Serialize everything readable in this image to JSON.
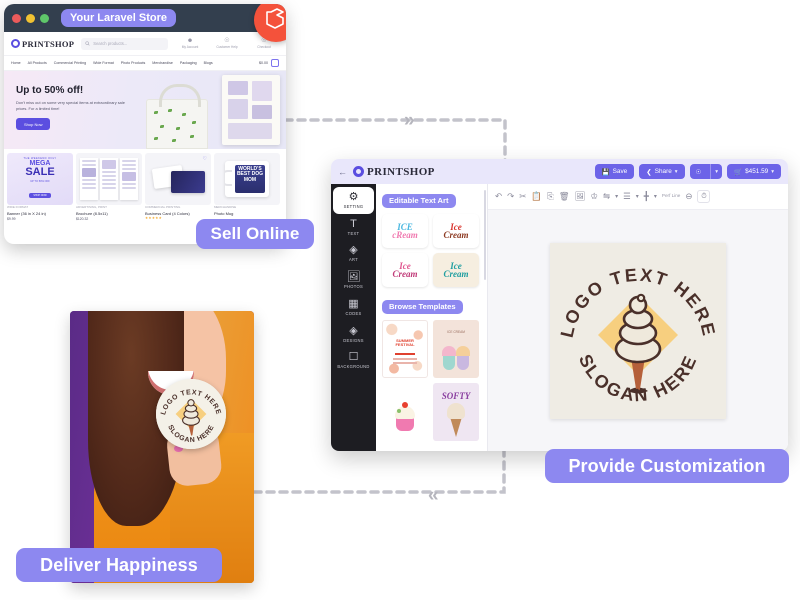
{
  "storefront": {
    "titlebar": {
      "label": "Your Laravel Store",
      "brand_icon": "laravel-logo-icon"
    },
    "header": {
      "logo_text": "PRINTSHOP",
      "search_placeholder": "Search products...",
      "actions": [
        {
          "icon": "user-account-icon",
          "label": "My Account"
        },
        {
          "icon": "help-circle-icon",
          "label": "Customer Help"
        },
        {
          "icon": "cart-checkout-icon",
          "label": "Checkout"
        }
      ]
    },
    "nav": {
      "items": [
        "Home",
        "All Products",
        "Commercial Printing",
        "Wide Format",
        "Photo Products",
        "Merchandise",
        "Packaging",
        "Blogs"
      ],
      "cart_total": "$0.00",
      "cart_count": "0"
    },
    "hero": {
      "title": "Up to 50% off!",
      "subtitle": "Don't miss out on some very special items at extraordinary sale prices. For a limited time!",
      "cta": "Shop Now"
    },
    "products": [
      {
        "category": "WIDE FORMAT",
        "name": "Banner (36 in X 24 in)",
        "price": "$9.99",
        "rating": "",
        "thumb": "mega-sale-banner",
        "banner": {
          "line1": "THE WEEKEND ONLY",
          "line2": "MEGA",
          "line3": "SALE",
          "line4": "UP TO 50% OFF",
          "line5": "SHOP NOW"
        }
      },
      {
        "category": "ADVERTISING, PRINT",
        "name": "Brochure (8.5x11)",
        "price": "$120.32",
        "rating": "",
        "thumb": "brochure-trifold"
      },
      {
        "category": "COMMERCIAL PRINTING",
        "name": "Business Card (4 Colors)",
        "price": "",
        "rating": "★★★★★",
        "thumb": "business-card"
      },
      {
        "category": "MERCHANDISE",
        "name": "Photo Mug",
        "price": "",
        "rating": "",
        "thumb": "photo-mug",
        "mug_text": "WORLD'S BEST DOG MOM"
      }
    ]
  },
  "editor": {
    "header": {
      "back_icon": "arrow-left-icon",
      "logo_text": "PRINTSHOP",
      "save_label": "Save",
      "save_icon": "save-disk-icon",
      "share_label": "Share",
      "share_icon": "share-nodes-icon",
      "account_icon": "user-circle-icon",
      "cart_label": "$451.59",
      "cart_icon": "cart-icon",
      "chevron_icon": "chevron-down-icon"
    },
    "rail": [
      {
        "label": "SETTING",
        "icon": "gear-icon",
        "active": true
      },
      {
        "label": "TEXT",
        "icon": "text-t-icon",
        "active": false
      },
      {
        "label": "ART",
        "icon": "shapes-icon",
        "active": false
      },
      {
        "label": "PHOTOS",
        "icon": "image-icon",
        "active": false
      },
      {
        "label": "CODES",
        "icon": "qr-code-icon",
        "active": false
      },
      {
        "label": "DESIGNS",
        "icon": "shapes-icon",
        "active": false
      },
      {
        "label": "BACKGROUND",
        "icon": "background-icon",
        "active": false
      }
    ],
    "panel": {
      "text_art_title": "Editable Text Art",
      "text_art_tiles": [
        {
          "name": "ice-cream-blue-art",
          "line1": "ICE",
          "line2": "cReam",
          "c1": "#49b7e0",
          "c2": "#f07ab0",
          "bg": "#ffffff"
        },
        {
          "name": "ice-cream-red-art",
          "line1": "Ice",
          "line2": "Cream",
          "c1": "#d8322c",
          "c2": "#8d3a22",
          "bg": "#ffffff"
        },
        {
          "name": "ice-cream-pink-art",
          "line1": "Ice",
          "line2": "Cream",
          "c1": "#e0568f",
          "c2": "#c03a78",
          "bg": "#ffffff"
        },
        {
          "name": "ice-cream-teal-art",
          "line1": "Ice",
          "line2": "Cream",
          "c1": "#1f9ea0",
          "c2": "#f0b73a",
          "bg": "#f6eee0"
        }
      ],
      "templates_title": "Browse Templates",
      "template_tiles": [
        {
          "name": "summer-festival-template",
          "title": "SUMMER FESTIVAL",
          "bg": "#ffffff",
          "accent": "#e0412f"
        },
        {
          "name": "ice-cream-shop-template",
          "title": "ICE CREAM",
          "bg": "#f3e3da",
          "accent": "#b07a6a"
        },
        {
          "name": "cupcake-template",
          "title": "",
          "bg": "#ffffff",
          "accent": "#e86fb0"
        },
        {
          "name": "softy-template",
          "title": "SOFTY",
          "bg": "#efe6f2",
          "accent": "#8a3fa0"
        }
      ]
    },
    "toolbar": {
      "items": [
        {
          "icon": "undo-icon",
          "name": "undo-button"
        },
        {
          "icon": "redo-icon",
          "name": "redo-button"
        },
        {
          "icon": "scissors-icon",
          "name": "cut-button"
        },
        {
          "icon": "copy-icon",
          "name": "copy-button"
        },
        {
          "icon": "paste-icon",
          "name": "paste-button"
        },
        {
          "icon": "trash-icon",
          "name": "delete-button"
        },
        {
          "icon": "image-frame-icon",
          "name": "image-button"
        },
        {
          "icon": "crown-icon",
          "name": "premium-button"
        },
        {
          "icon": "flip-horizontal-icon",
          "name": "flip-button"
        },
        {
          "icon": "align-icon",
          "name": "align-button"
        },
        {
          "icon": "distribute-icon",
          "name": "distribute-button"
        }
      ],
      "perf_line_label": "Perf Line",
      "minus_icon": "minus-circle-icon",
      "history_icon": "history-clock-icon"
    },
    "canvas": {
      "top_text": "LOGO TEXT HERE",
      "bottom_text": "SLOGAN HERE",
      "art": "ice-cream-cone-logo",
      "bg_color": "#efece4",
      "diamond_color": "#f7cf7f",
      "ink_color": "#4a302a"
    }
  },
  "photo": {
    "alt": "woman-holding-logo-sticker",
    "sticker_top_text": "LOGO TEXT HERE",
    "sticker_bottom_text": "SLOGAN HERE"
  },
  "labels": {
    "sell_online": "Sell Online",
    "provide_customization": "Provide Customization",
    "deliver_happiness": "Deliver Happiness"
  },
  "colors": {
    "accent": "#8d88f0",
    "brand": "#5b4ee0",
    "laravel": "#f4523b",
    "dark": "#1d1d22",
    "titlebar": "#333f4e"
  }
}
